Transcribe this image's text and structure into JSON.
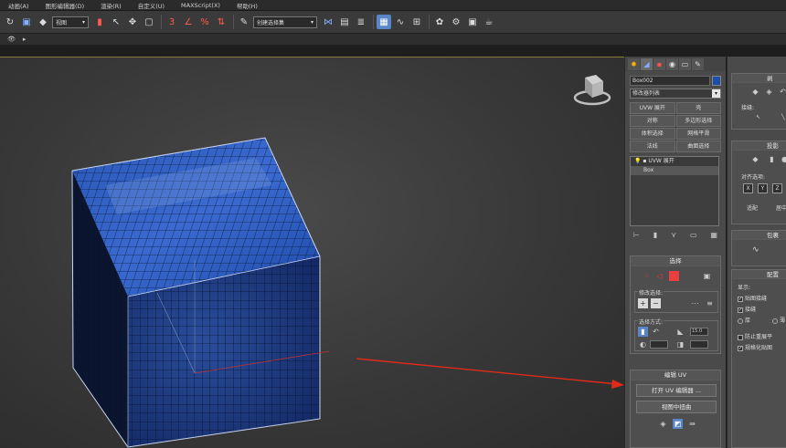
{
  "menu": [
    "动画(A)",
    "图形编辑器(D)",
    "渲染(R)",
    "自定义(U)",
    "MAXScript(X)",
    "帮助(H)"
  ],
  "toolbar": {
    "view_select": "视图",
    "snap_label": "3",
    "selection_set": "创建选择集"
  },
  "panel": {
    "object_name": "Box002",
    "object_color": "#1d4fa8",
    "modifier_list": "修改器列表",
    "buttons": [
      "UVW 展开",
      "壳",
      "对称",
      "多边形选择",
      "体积选择",
      "网格平滑",
      "法线",
      "曲面选择"
    ],
    "stack": {
      "modifier": "UVW 展开",
      "base": "Box"
    },
    "selection_rollout": {
      "title": "选择",
      "modify_group": "修改选择:",
      "method_group": "选择方式:",
      "spinner_value": "15.0"
    },
    "edit_uv_rollout": {
      "title": "编辑 UV",
      "open_editor": "打开 UV 编辑器 ...",
      "tweak_in_view": "视图中扭曲"
    }
  },
  "right_panel": {
    "section1_title": "剥",
    "section1_label": "接缝:",
    "section2_title": "投影",
    "align_label": "对齐选项:",
    "axes": [
      "X",
      "Y",
      "Z"
    ],
    "btn_fit": "适配",
    "btn_center": "居中",
    "section3_title": "包裹",
    "section4_title": "配置",
    "display_label": "显示:",
    "options": [
      "贴图接缝",
      "接缝",
      "厚",
      "薄",
      "防止重展平",
      "规格化贴图"
    ]
  },
  "colors": {
    "cube_blue": "#1f3f8a",
    "annotation_red": "#e02a1a"
  }
}
